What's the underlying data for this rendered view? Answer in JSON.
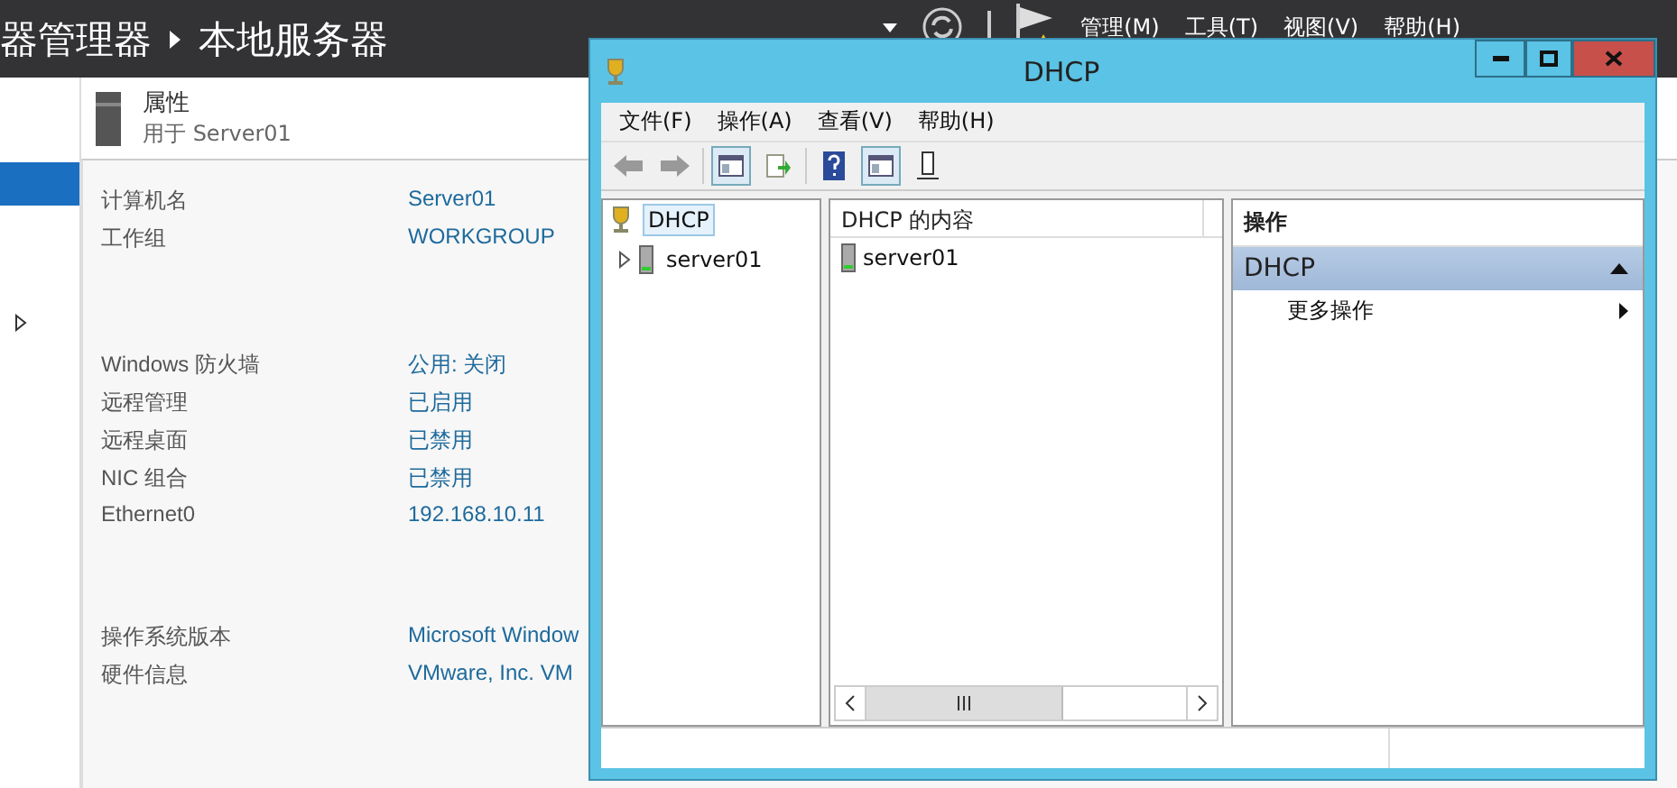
{
  "server_manager": {
    "breadcrumb": [
      "器管理器",
      "本地服务器"
    ],
    "menus": [
      "管理(M)",
      "工具(T)",
      "视图(V)",
      "帮助(H)"
    ],
    "properties": {
      "title": "属性",
      "subtitle": "用于 Server01",
      "groups": [
        [
          {
            "label": "计算机名",
            "value": "Server01"
          },
          {
            "label": "工作组",
            "value": "WORKGROUP"
          }
        ],
        [
          {
            "label": "Windows 防火墙",
            "value": "公用: 关闭"
          },
          {
            "label": "远程管理",
            "value": "已启用"
          },
          {
            "label": "远程桌面",
            "value": "已禁用"
          },
          {
            "label": "NIC 组合",
            "value": "已禁用"
          },
          {
            "label": "Ethernet0",
            "value": "192.168.10.11"
          }
        ],
        [
          {
            "label": "操作系统版本",
            "value": "Microsoft Window"
          },
          {
            "label": "硬件信息",
            "value": "VMware, Inc. VM"
          }
        ]
      ]
    }
  },
  "dhcp_window": {
    "title": "DHCP",
    "menus": [
      "文件(F)",
      "操作(A)",
      "查看(V)",
      "帮助(H)"
    ],
    "tree": [
      {
        "label": "DHCP",
        "selected": true,
        "children": [
          {
            "label": "server01",
            "expanded": false
          }
        ]
      }
    ],
    "content": {
      "columns": [
        "DHCP 的内容"
      ],
      "rows": [
        "server01"
      ]
    },
    "actions": {
      "title": "操作",
      "section": "DHCP",
      "expanded": true,
      "items": [
        "更多操作"
      ]
    }
  }
}
